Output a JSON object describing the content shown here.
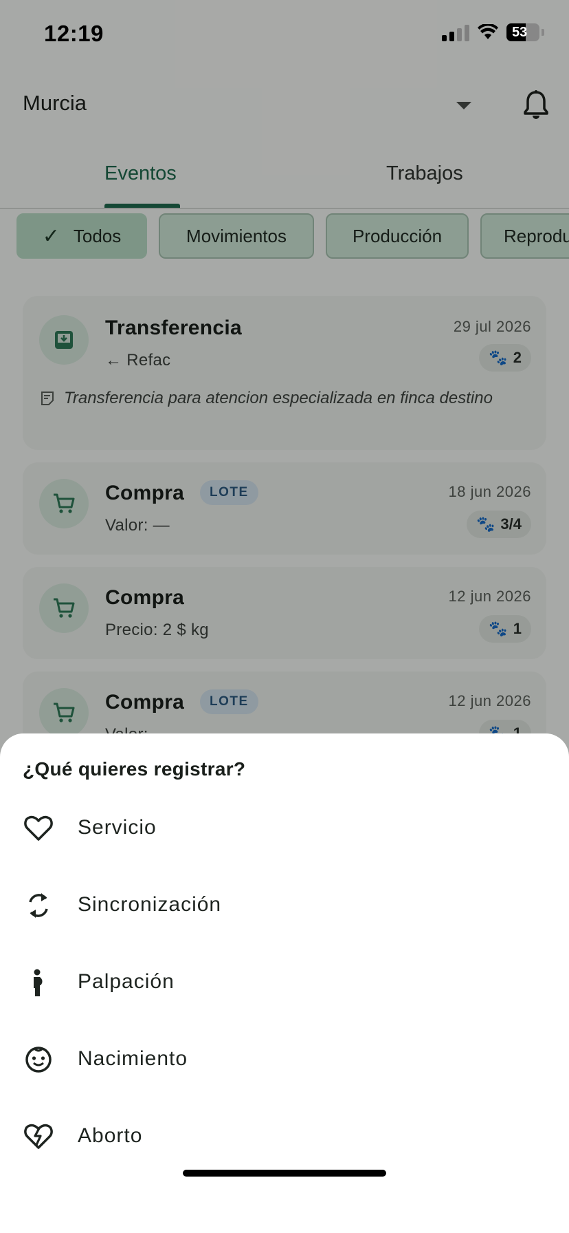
{
  "status_bar": {
    "time": "12:19",
    "battery": "53"
  },
  "app_bar": {
    "farm": "Murcia"
  },
  "tabs": [
    {
      "label": "Eventos",
      "active": true
    },
    {
      "label": "Trabajos",
      "active": false
    }
  ],
  "filters": [
    {
      "label": "Todos",
      "selected": true
    },
    {
      "label": "Movimientos",
      "selected": false
    },
    {
      "label": "Producción",
      "selected": false
    },
    {
      "label": "Reprodu",
      "selected": false
    }
  ],
  "events": [
    {
      "title": "Transferencia",
      "subtitle": "← Refac",
      "date": "29 jul 2026",
      "count": "2",
      "note": "Transferencia para atencion especializada en finca destino",
      "icon": "inbox-download-icon"
    },
    {
      "title": "Compra",
      "badge": "LOTE",
      "subtitle": "Valor: —",
      "date": "18 jun 2026",
      "count": "3/4",
      "icon": "cart-icon"
    },
    {
      "title": "Compra",
      "subtitle": "Precio: 2 $ kg",
      "date": "12 jun 2026",
      "count": "1",
      "icon": "cart-icon"
    },
    {
      "title": "Compra",
      "badge": "LOTE",
      "subtitle": "Valor:",
      "date": "12 jun 2026",
      "count": "1",
      "icon": "cart-icon"
    }
  ],
  "sheet": {
    "title": "¿Qué quieres registrar?",
    "items": [
      {
        "label": "Servicio",
        "icon": "heart-icon"
      },
      {
        "label": "Sincronización",
        "icon": "sync-icon"
      },
      {
        "label": "Palpación",
        "icon": "pregnant-icon"
      },
      {
        "label": "Nacimiento",
        "icon": "baby-face-icon"
      },
      {
        "label": "Aborto",
        "icon": "broken-heart-icon"
      }
    ]
  },
  "colors": {
    "primary": "#1f6b4e",
    "chip_bg": "#cfe8d8",
    "lote_text": "#2d5a80",
    "lote_bg": "#d3e3ee"
  }
}
